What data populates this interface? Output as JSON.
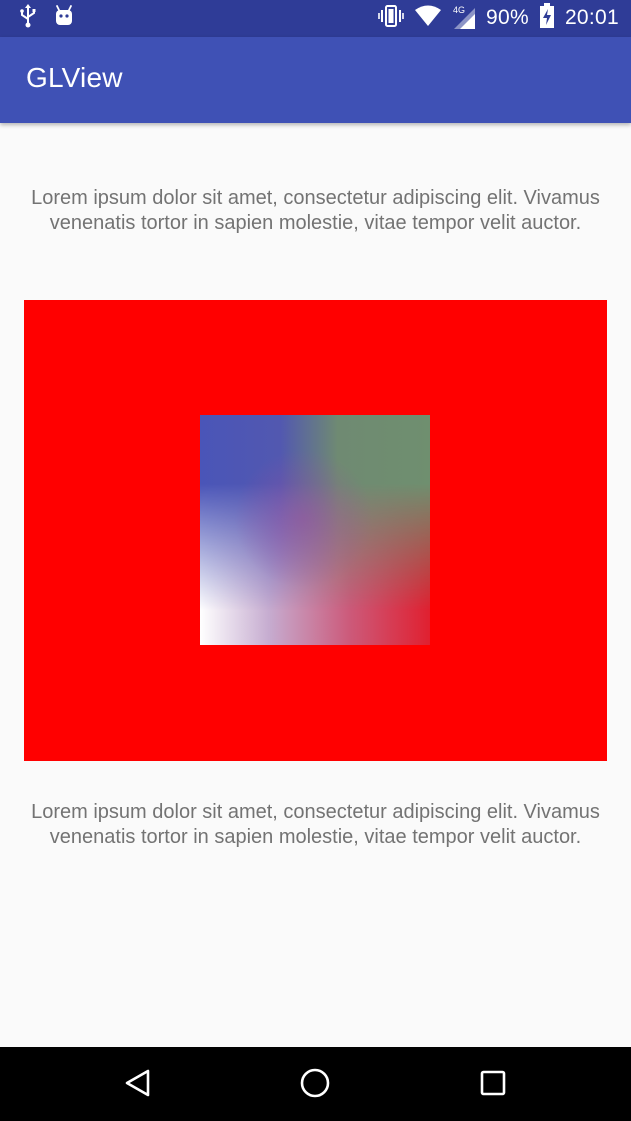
{
  "status_bar": {
    "left_icons": [
      "usb-icon",
      "android-debug-icon"
    ],
    "right_icons": [
      "vibrate-icon",
      "wifi-icon",
      "cellular-4g-icon",
      "battery-icon"
    ],
    "network_type": "4G",
    "battery_percent": "90%",
    "battery_level": 0.9,
    "time": "20:01"
  },
  "app_bar": {
    "title": "GLView"
  },
  "content": {
    "top_text": "Lorem ipsum dolor sit amet, consectetur adipiscing elit. Vivamus venenatis tortor in sapien molestie, vitae tempor velit auctor.",
    "bottom_text": "Lorem ipsum dolor sit amet, consectetur adipiscing elit. Vivamus venenatis tortor in sapien molestie, vitae tempor velit auctor.",
    "gl_view": {
      "clear_color": "#ff0000",
      "quad_corner_colors": {
        "top_left": "#3f51b5",
        "top_right": "#6f8f6f",
        "bottom_left": "#ffffff",
        "bottom_right": "#ff0000"
      }
    }
  },
  "nav_bar": {
    "buttons": [
      "back-icon",
      "home-icon",
      "recents-icon"
    ]
  },
  "colors": {
    "status_bar": "#2f3c97",
    "app_bar": "#3f51b5",
    "background": "#fafafa",
    "text": "#737373",
    "nav_bar": "#000000"
  }
}
